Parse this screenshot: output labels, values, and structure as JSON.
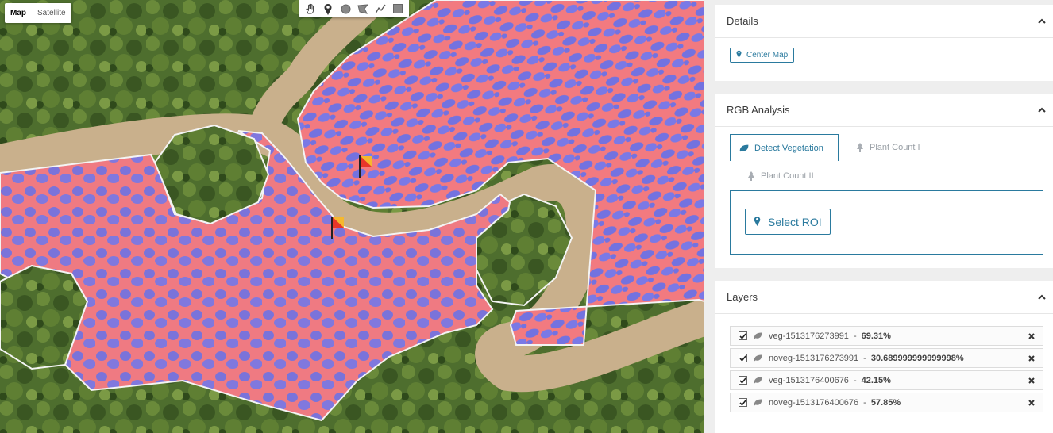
{
  "map": {
    "map_types": [
      {
        "label": "Map",
        "active": true
      },
      {
        "label": "Satellite",
        "active": false
      }
    ],
    "tools": [
      "hand-icon",
      "marker-icon",
      "circle-icon",
      "polygon-icon",
      "polyline-icon",
      "rectangle-icon"
    ],
    "colors": {
      "vegetation": "#6e6ee0",
      "non_vegetation": "#f07078",
      "road": "#c8b08a",
      "trees": "#3d5e22"
    }
  },
  "details": {
    "title": "Details",
    "center_map_label": "Center Map"
  },
  "rgb": {
    "title": "RGB Analysis",
    "tabs": [
      {
        "label": "Detect Vegetation",
        "active": true,
        "icon": "leaf-icon"
      },
      {
        "label": "Plant Count I",
        "active": false,
        "icon": "tree-icon"
      },
      {
        "label": "Plant Count II",
        "active": false,
        "icon": "tree-icon"
      }
    ],
    "select_roi_label": "Select ROI"
  },
  "layers": {
    "title": "Layers",
    "items": [
      {
        "name": "veg-1513176273991",
        "value": "69.31%",
        "checked": true
      },
      {
        "name": "noveg-1513176273991",
        "value": "30.689999999999998%",
        "checked": true
      },
      {
        "name": "veg-1513176400676",
        "value": "42.15%",
        "checked": true
      },
      {
        "name": "noveg-1513176400676",
        "value": "57.85%",
        "checked": true
      }
    ]
  },
  "colors": {
    "accent": "#2a7a9e"
  }
}
